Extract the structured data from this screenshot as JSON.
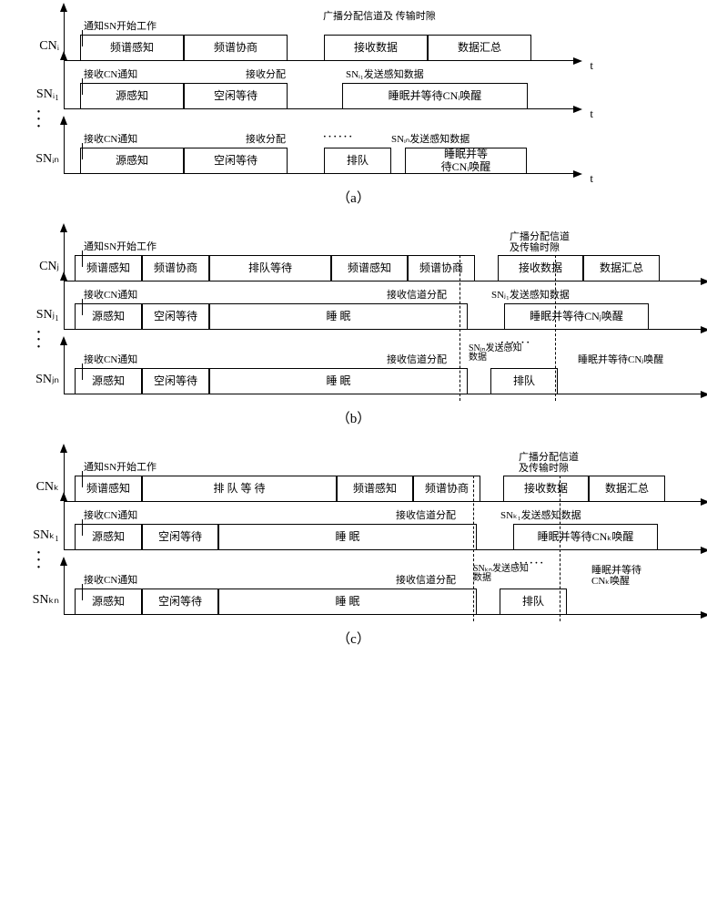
{
  "a": {
    "cn": {
      "label": "CNᵢ",
      "a1": "通知SN开始工作",
      "a2": "广播分配信道及\n传输时隙",
      "c1": "频谱感知",
      "c2": "频谱协商",
      "c3": "接收数据",
      "c4": "数据汇总"
    },
    "sn1": {
      "label": "SNᵢ₁",
      "a1": "接收CN通知",
      "a2": "接收分配",
      "a3": "SNᵢ₁发送感知数据",
      "c1": "源感知",
      "c2": "空闲等待",
      "c3": "睡眠并等待CNᵢ唤醒"
    },
    "snn": {
      "label": "SNᵢₙ",
      "a1": "接收CN通知",
      "a2": "接收分配",
      "a3": "SNᵢₙ发送感知数据",
      "c1": "源感知",
      "c2": "空闲等待",
      "c3": "排队",
      "c4": "睡眠并等\n待CNᵢ唤醒",
      "dots": "······"
    },
    "cap": "（a）"
  },
  "b": {
    "cn": {
      "label": "CNⱼ",
      "a1": "通知SN开始工作",
      "a2": "广播分配信道\n及传输时隙",
      "c1": "频谱感知",
      "c2": "频谱协商",
      "c3": "排队等待",
      "c4": "频谱感知",
      "c5": "频谱协商",
      "c6": "接收数据",
      "c7": "数据汇总"
    },
    "sn1": {
      "label": "SNⱼ₁",
      "a1": "接收CN通知",
      "a2": "接收信道分配",
      "a3": "SNⱼ₁发送感知数据",
      "c1": "源感知",
      "c2": "空闲等待",
      "c3": "睡  眠",
      "c4": "睡眠并等待CNⱼ唤醒"
    },
    "snn": {
      "label": "SNⱼₙ",
      "a1": "接收CN通知",
      "a2": "接收信道分配",
      "a3": "SNⱼₙ发送感知\n数据",
      "a4": "睡眠并等待CNⱼ唤醒",
      "c1": "源感知",
      "c2": "空闲等待",
      "c3": "睡  眠",
      "c4": "排队",
      "dots": "······"
    },
    "cap": "（b）"
  },
  "c": {
    "cn": {
      "label": "CNₖ",
      "a1": "通知SN开始工作",
      "a2": "广播分配信道\n及传输时隙",
      "c1": "频谱感知",
      "c2": "排 队 等 待",
      "c3": "频谱感知",
      "c4": "频谱协商",
      "c5": "接收数据",
      "c6": "数据汇总"
    },
    "sn1": {
      "label": "SNₖ₁",
      "a1": "接收CN通知",
      "a2": "接收信道分配",
      "a3": "SNₖ₁发送感知数据",
      "c1": "源感知",
      "c2": "空闲等待",
      "c3": "睡  眠",
      "c4": "睡眠并等待CNₖ唤醒"
    },
    "snn": {
      "label": "SNₖₙ",
      "a1": "接收CN通知",
      "a2": "接收信道分配",
      "a3": "SNₖₙ发送感知\n数据",
      "a4": "睡眠并等待\nCNₖ唤醒",
      "c1": "源感知",
      "c2": "空闲等待",
      "c3": "睡  眠",
      "c4": "排队",
      "dots": "······"
    },
    "cap": "（c）"
  },
  "t": "t"
}
